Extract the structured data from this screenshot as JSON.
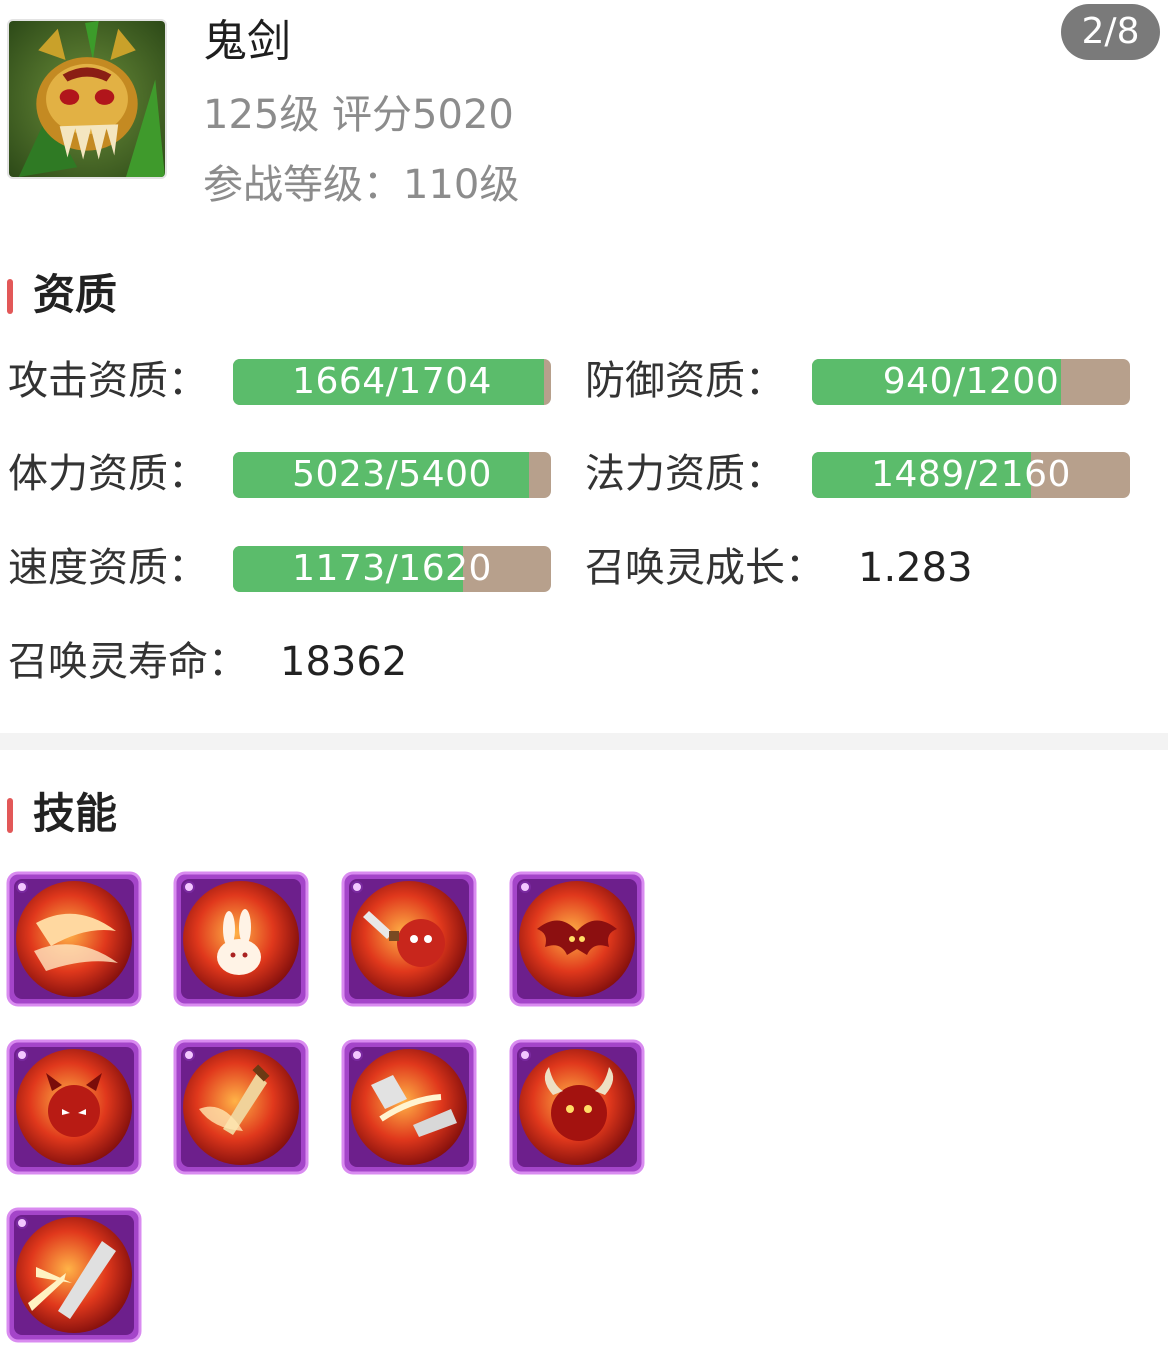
{
  "pet": {
    "name": "鬼剑",
    "meta": "125级 评分5020",
    "battle_level": "参战等级：110级",
    "avatar_icon": "ghost-sword-portrait"
  },
  "pager": {
    "label": "2/8"
  },
  "aptitude": {
    "title": "资质",
    "stats": [
      {
        "label": "攻击资质：",
        "value": "1664/1704",
        "current": 1664,
        "max": 1704
      },
      {
        "label": "防御资质：",
        "value": "940/1200",
        "current": 940,
        "max": 1200
      },
      {
        "label": "体力资质：",
        "value": "5023/5400",
        "current": 5023,
        "max": 5400
      },
      {
        "label": "法力资质：",
        "value": "1489/2160",
        "current": 1489,
        "max": 2160
      },
      {
        "label": "速度资质：",
        "value": "1173/1620",
        "current": 1173,
        "max": 1620
      }
    ],
    "growth": {
      "label": "召唤灵成长：",
      "value": "1.283"
    },
    "lifespan": {
      "label": "召唤灵寿命：",
      "value": "18362"
    }
  },
  "skills": {
    "title": "技能",
    "items": [
      {
        "icon": "fire-slash-skill-icon"
      },
      {
        "icon": "fire-rabbit-skill-icon"
      },
      {
        "icon": "demon-dagger-skill-icon"
      },
      {
        "icon": "fire-bat-skill-icon"
      },
      {
        "icon": "fire-demon-skill-icon"
      },
      {
        "icon": "flaming-sword-skill-icon"
      },
      {
        "icon": "sword-strike-skill-icon"
      },
      {
        "icon": "horned-demon-skill-icon"
      },
      {
        "icon": "blade-burst-skill-icon"
      }
    ]
  },
  "colors": {
    "bar_fill": "#5bbc6b",
    "bar_track": "#b7a08c",
    "accent": "#e25858",
    "skill_frame": "#a445c9"
  }
}
